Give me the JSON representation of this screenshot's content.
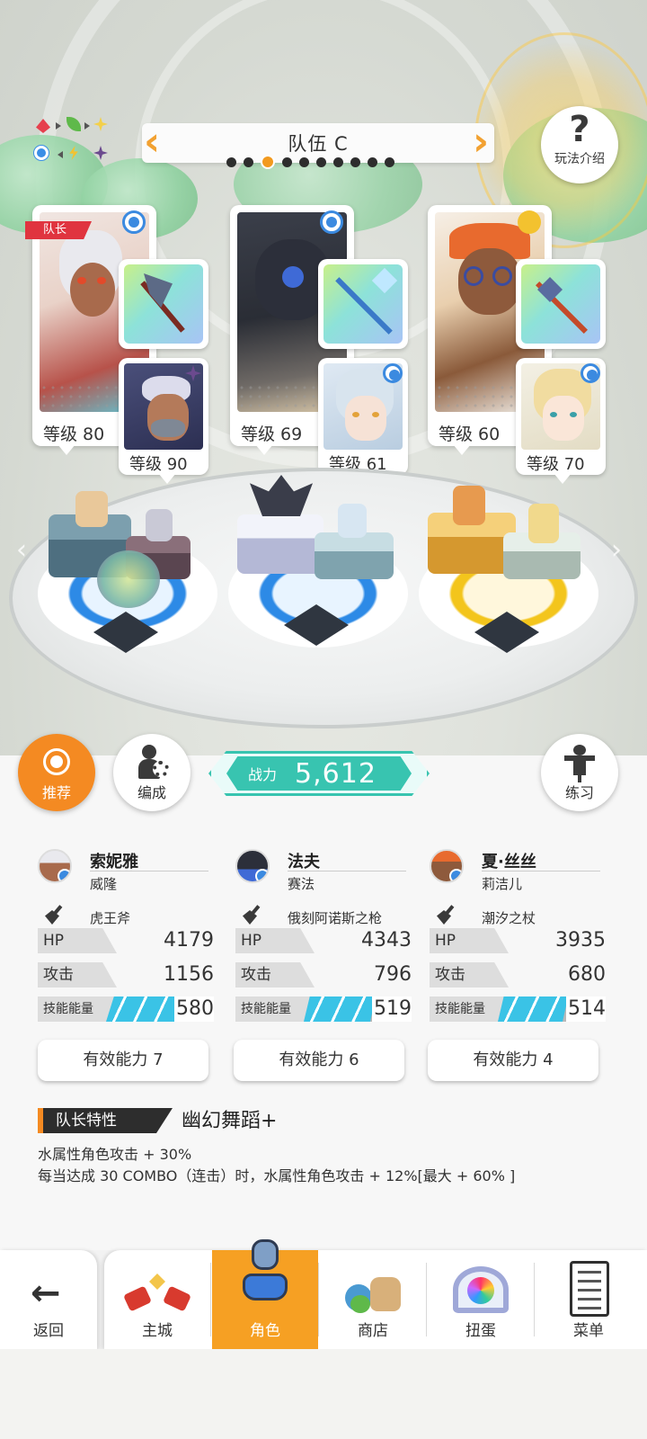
{
  "header": {
    "team_title": "队伍 C",
    "help_label": "玩法介绍",
    "team_page_count": 10,
    "active_team_index": 2
  },
  "team": [
    {
      "level_label": "等级 80",
      "leader_tag": "队长",
      "sub_level_label": "等级 90"
    },
    {
      "level_label": "等级 69",
      "sub_level_label": "等级 61"
    },
    {
      "level_label": "等级 60",
      "sub_level_label": "等级 70"
    }
  ],
  "actions": {
    "recommend_label": "推荐",
    "formation_label": "编成",
    "practice_label": "练习",
    "power_label": "战力",
    "power_value": "5,612"
  },
  "members": [
    {
      "name": "索妮雅",
      "sub_name": "威隆",
      "weapon": "虎王斧",
      "hp_label": "HP",
      "hp": "4179",
      "atk_label": "攻击",
      "atk": "1156",
      "energy_label": "技能能量",
      "energy": "580",
      "ability": "有效能力 7"
    },
    {
      "name": "法夫",
      "sub_name": "赛法",
      "weapon": "俄刻阿诺斯之枪",
      "hp_label": "HP",
      "hp": "4343",
      "atk_label": "攻击",
      "atk": "796",
      "energy_label": "技能能量",
      "energy": "519",
      "ability": "有效能力 6"
    },
    {
      "name": "夏·丝丝",
      "sub_name": "莉洁儿",
      "weapon": "潮汐之杖",
      "hp_label": "HP",
      "hp": "3935",
      "atk_label": "攻击",
      "atk": "680",
      "energy_label": "技能能量",
      "energy": "514",
      "ability": "有效能力 4"
    }
  ],
  "leader_trait": {
    "label": "队长特性",
    "name": "幽幻舞蹈+",
    "line1": "水属性角色攻击 + 30%",
    "line2": "每当达成 30 COMBO（连击）时，水属性角色攻击 + 12%[最大 + 60% ]"
  },
  "nav": {
    "back": "返回",
    "tabs": [
      "主城",
      "角色",
      "商店",
      "扭蛋",
      "菜单"
    ],
    "active": "角色"
  },
  "colors": {
    "accent": "#f6a023",
    "power": "#38c4b0",
    "water": "#3b8ae0",
    "leader": "#e0343f"
  }
}
